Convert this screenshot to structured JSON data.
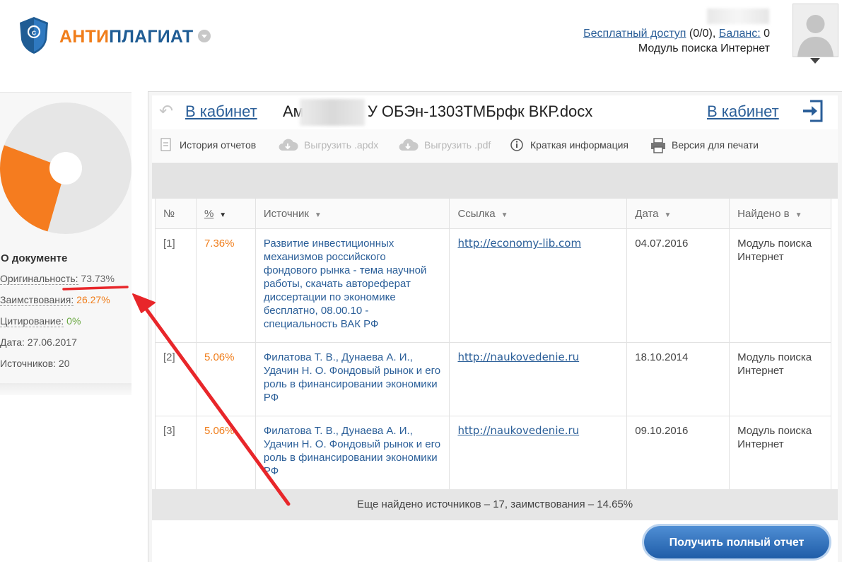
{
  "brand": {
    "name_part1": "АНТИ",
    "name_part2": "ПЛАГИАТ"
  },
  "account": {
    "free_access_label": "Бесплатный доступ",
    "free_access_value": "(0/0),",
    "balance_label": "Баланс:",
    "balance_value": "0",
    "module": "Модуль поиска Интернет"
  },
  "sidebar": {
    "pie": {
      "borrowings_percent": 26.27,
      "originality_percent": 73.73,
      "borrowings_color": "#f57c1f",
      "originality_color": "#e6e6e6"
    },
    "about_title": "О документе",
    "originality_label": "Оригинальность:",
    "originality_value": "73.73%",
    "borrowing_label": "Заимствования:",
    "borrowing_value": "26.27%",
    "citation_label": "Цитирование:",
    "citation_value": "0%",
    "date_text": "Дата: 27.06.2017",
    "sources_text": "Источников: 20"
  },
  "report": {
    "cabinet_link": "В кабинет",
    "doc_name_start": "Ам",
    "doc_name_end": "У ОБЭн-1303ТМБрфк ВКР.docx",
    "cabinet_link_right": "В кабинет"
  },
  "toolbar": {
    "history": "История отчетов",
    "export_apdx": "Выгрузить .apdx",
    "export_pdf": "Выгрузить .pdf",
    "brief_info": "Краткая информация",
    "print_version": "Версия для печати"
  },
  "table": {
    "headers": {
      "num": "№",
      "pct": "%",
      "source": "Источник",
      "link": "Ссылка",
      "date": "Дата",
      "found_in": "Найдено в"
    },
    "rows": [
      {
        "num": "[1]",
        "pct": "7.36%",
        "source": "Развитие инвестиционных механизмов российского фондового рынка - тема научной работы, скачать автореферат диссертации по экономике бесплатно, 08.00.10 - специальность ВАК РФ",
        "link": "http://economy-lib.com",
        "date": "04.07.2016",
        "found_in": "Модуль поиска Интернет"
      },
      {
        "num": "[2]",
        "pct": "5.06%",
        "source": "Филатова Т. В., Дунаева А. И., Удачин Н. О. Фондовый рынок и его роль в финансировании экономики РФ",
        "link": "http://naukovedenie.ru",
        "date": "18.10.2014",
        "found_in": "Модуль поиска Интернет"
      },
      {
        "num": "[3]",
        "pct": "5.06%",
        "source": "Филатова Т. В., Дунаева А. И., Удачин Н. О. Фондовый рынок и его роль в финансировании экономики РФ",
        "link": "http://naukovedenie.ru",
        "date": "09.10.2016",
        "found_in": "Модуль поиска Интернет"
      }
    ]
  },
  "more_sources": "Еще найдено источников – 17, заимствования – 14.65%",
  "full_report_button": "Получить полный отчет",
  "annotation_color": "#e8262a"
}
